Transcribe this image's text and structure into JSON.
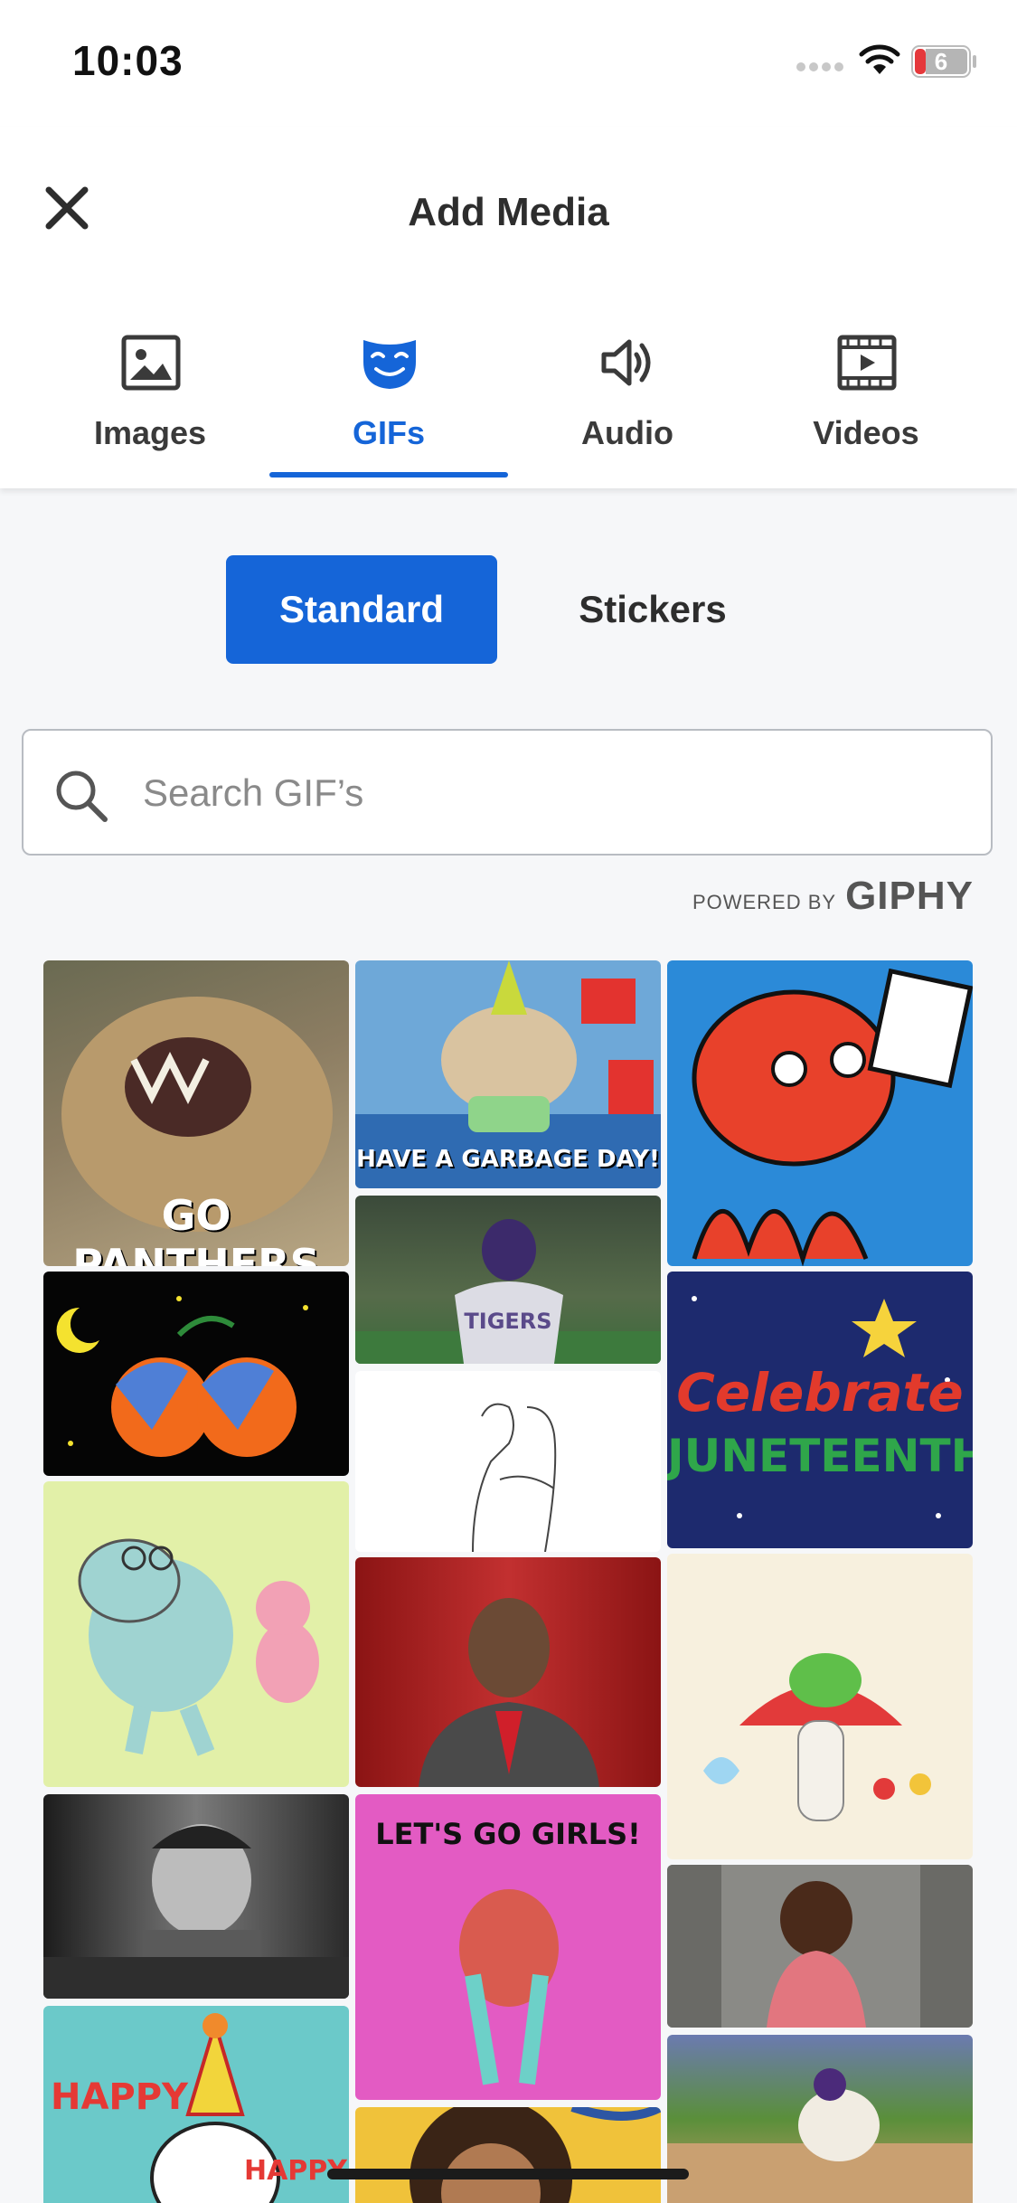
{
  "status": {
    "time": "10:03",
    "battery": "6"
  },
  "header": {
    "title": "Add Media"
  },
  "tabs": [
    {
      "label": "Images",
      "icon": "image-icon"
    },
    {
      "label": "GIFs",
      "icon": "gif-mask-icon"
    },
    {
      "label": "Audio",
      "icon": "speaker-icon"
    },
    {
      "label": "Videos",
      "icon": "video-icon"
    }
  ],
  "segment": {
    "standard": "Standard",
    "stickers": "Stickers"
  },
  "search": {
    "placeholder": "Search GIF’s"
  },
  "powered": {
    "prefix": "POWERED BY",
    "brand": "GIPHY"
  },
  "gifs": {
    "go_panthers": "GO PANTHERS",
    "garbage_day": "HAVE A GARBAGE DAY!",
    "tigers": "TIGERS",
    "celebrate": "Celebrate",
    "juneteenth": "JUNETEENTH",
    "lets_go_girls": "LET'S GO GIRLS!",
    "happy1": "HAPPY",
    "happy2": "HAPPY"
  },
  "colors": {
    "accent": "#1565d8"
  }
}
